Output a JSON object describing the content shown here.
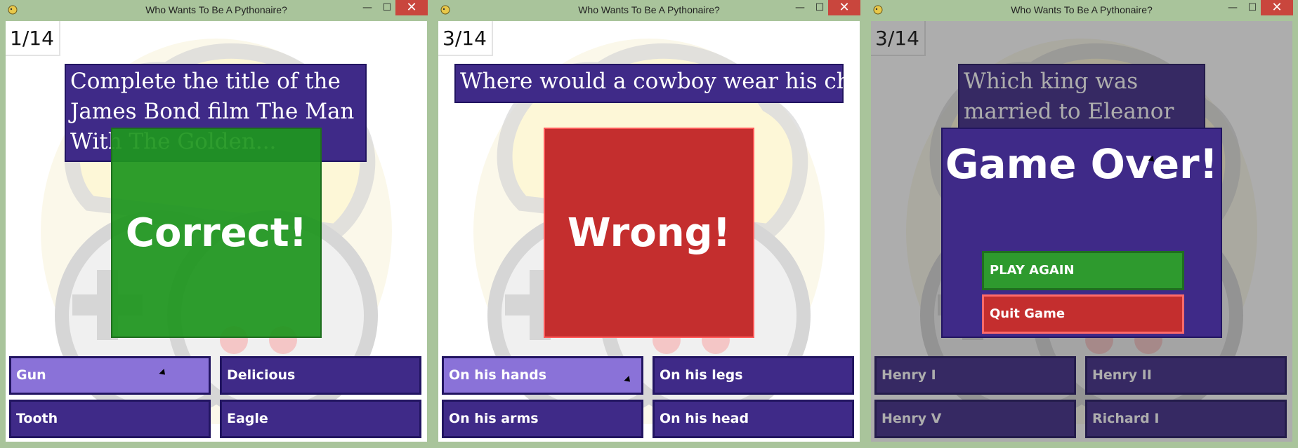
{
  "windows": [
    {
      "title": "Who Wants To Be A Pythonaire?",
      "counter": "1/14",
      "question": "Complete the title of the James Bond film The Man With The Golden...",
      "result": "Correct!",
      "answers": [
        "Gun",
        "Delicious",
        "Tooth",
        "Eagle"
      ]
    },
    {
      "title": "Who Wants To Be A Pythonaire?",
      "counter": "3/14",
      "question": "Where would a cowboy wear his chaps?",
      "result": "Wrong!",
      "answers": [
        "On his hands",
        "On his legs",
        "On his arms",
        "On his head"
      ]
    },
    {
      "title": "Who Wants To Be A Pythonaire?",
      "counter": "3/14",
      "question": "Which king was married to Eleanor of Aquitaine?",
      "game_over": "Game Over!",
      "play_again": "PLAY AGAIN",
      "quit": "Quit Game",
      "answers": [
        "Henry I",
        "Henry II",
        "Henry V",
        "Richard I"
      ]
    }
  ],
  "window_controls": {
    "minimize": "—",
    "maximize": "☐",
    "close": "✕"
  },
  "colors": {
    "correct": "#2e9a2e",
    "wrong": "#c42e2e",
    "panel": "#3f2a88",
    "panel_border": "#221561",
    "hover": "#8a72d8"
  }
}
